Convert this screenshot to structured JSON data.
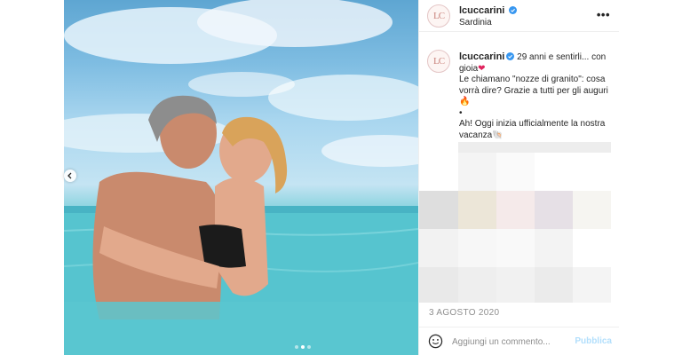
{
  "post": {
    "username": "lcuccarini",
    "avatar_initials": "LC",
    "location": "Sardinia",
    "more_label": "•••",
    "caption_line1": "29 anni e sentirli... con gioia",
    "caption_line2": "Le chiamano \"nozze di granito\": cosa vorrà dire? Grazie a tutti per gli auguri",
    "caption_line3": "•",
    "caption_line4": "Ah! Oggi inizia ufficialmente la nostra vacanza",
    "date": "3 AGOSTO 2020"
  },
  "comment_box": {
    "placeholder": "Aggiungi un commento...",
    "publish_label": "Pubblica"
  },
  "carousel": {
    "total_slides": 3,
    "active_index": 1
  },
  "icons": {
    "verified": "verified-badge-icon",
    "more": "more-options-icon",
    "prev": "chevron-left-icon",
    "emoji": "smiley-icon"
  },
  "colors": {
    "verified": "#3897f0",
    "publish_disabled": "#b2dffc",
    "secondary_text": "#8e8e8e",
    "avatar_ring": "#c9837c"
  }
}
